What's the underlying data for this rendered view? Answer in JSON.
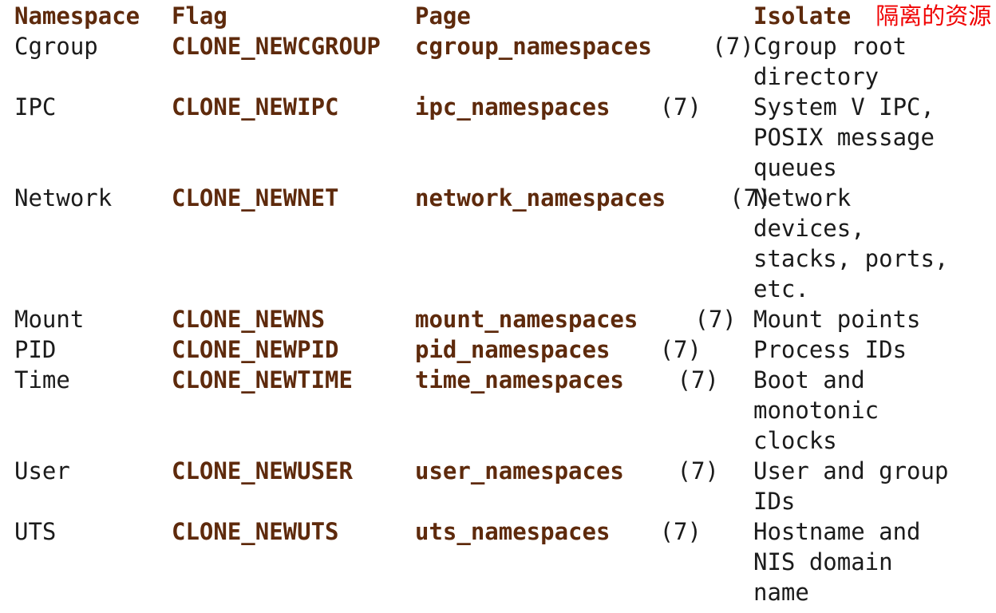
{
  "document": {
    "kind": "man-page-table",
    "colors": {
      "background": "#ffffff",
      "text": "#1b1b1b",
      "keyword_brown": "#5e2a0c",
      "annotation_red": "#f00000"
    }
  },
  "table": {
    "headers": {
      "namespace": "Namespace",
      "flag": "Flag",
      "page": "Page",
      "isolates": "Isolate",
      "isolates_annotation": "隔离的资源"
    },
    "rows": [
      {
        "namespace": "Cgroup",
        "flag": "CLONE_NEWCGROUP",
        "page_name": "cgroup_namespaces",
        "page_section": "(7)",
        "isolates_lines": [
          "Cgroup root",
          "directory"
        ]
      },
      {
        "namespace": "IPC",
        "flag": "CLONE_NEWIPC",
        "page_name": "ipc_namespaces",
        "page_section": "(7)",
        "isolates_lines": [
          "System V IPC,",
          "POSIX message",
          "queues"
        ]
      },
      {
        "namespace": "Network",
        "flag": "CLONE_NEWNET",
        "page_name": "network_namespaces",
        "page_section": "(7)",
        "isolates_lines": [
          "Network",
          "devices,",
          "stacks, ports,",
          "etc."
        ]
      },
      {
        "namespace": "Mount",
        "flag": "CLONE_NEWNS",
        "page_name": "mount_namespaces",
        "page_section": "(7)",
        "isolates_lines": [
          "Mount points"
        ]
      },
      {
        "namespace": "PID",
        "flag": "CLONE_NEWPID",
        "page_name": "pid_namespaces",
        "page_section": "(7)",
        "isolates_lines": [
          "Process IDs"
        ]
      },
      {
        "namespace": "Time",
        "flag": "CLONE_NEWTIME",
        "page_name": "time_namespaces",
        "page_section": "(7)",
        "isolates_lines": [
          "Boot and",
          "monotonic",
          "clocks"
        ]
      },
      {
        "namespace": "User",
        "flag": "CLONE_NEWUSER",
        "page_name": "user_namespaces",
        "page_section": "(7)",
        "isolates_lines": [
          "User and group",
          "IDs"
        ]
      },
      {
        "namespace": "UTS",
        "flag": "CLONE_NEWUTS",
        "page_name": "uts_namespaces",
        "page_section": "(7)",
        "isolates_lines": [
          "Hostname and",
          "NIS domain",
          "name"
        ]
      }
    ]
  }
}
